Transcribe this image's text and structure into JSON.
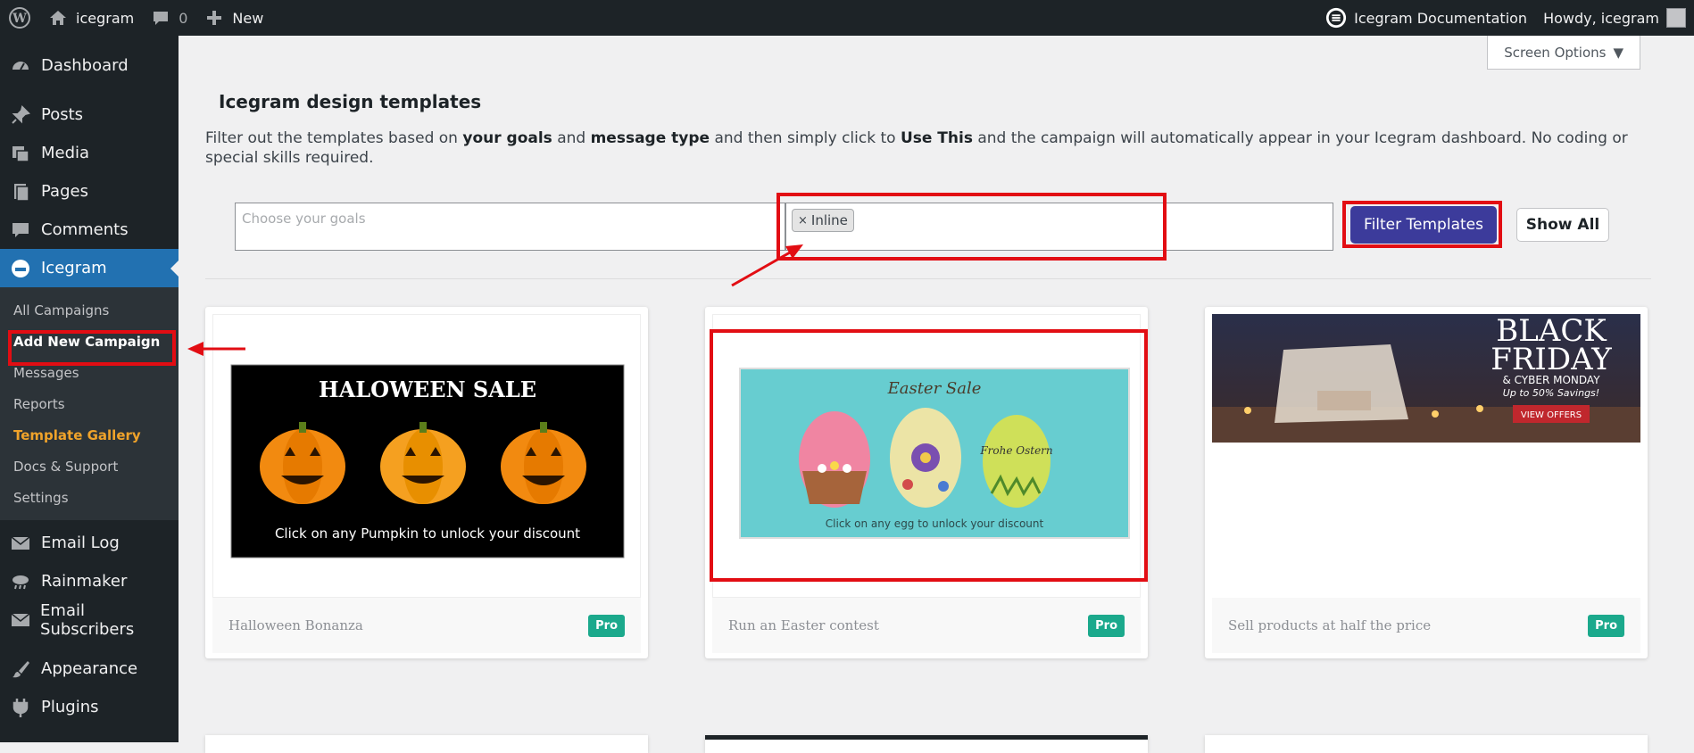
{
  "adminbar": {
    "site_name": "icegram",
    "comments_count": "0",
    "new_label": "New",
    "docs_label": "Icegram Documentation",
    "howdy": "Howdy, icegram"
  },
  "sidebar": {
    "items": [
      {
        "label": "Dashboard",
        "icon": "dashboard-icon"
      },
      {
        "label": "Posts",
        "icon": "pin-icon"
      },
      {
        "label": "Media",
        "icon": "media-icon"
      },
      {
        "label": "Pages",
        "icon": "pages-icon"
      },
      {
        "label": "Comments",
        "icon": "comment-icon"
      },
      {
        "label": "Icegram",
        "icon": "icegram-icon"
      },
      {
        "label": "Email Log",
        "icon": "email-icon"
      },
      {
        "label": "Rainmaker",
        "icon": "cloud-icon"
      },
      {
        "label": "Email Subscribers",
        "icon": "email-icon"
      },
      {
        "label": "Appearance",
        "icon": "brush-icon"
      },
      {
        "label": "Plugins",
        "icon": "plug-icon"
      }
    ],
    "submenu": [
      "All Campaigns",
      "Add New Campaign",
      "Messages",
      "Reports",
      "Template Gallery",
      "Docs & Support",
      "Settings"
    ]
  },
  "main": {
    "screen_options": "Screen Options",
    "title": "Icegram design templates",
    "desc_1": "Filter out the templates based on ",
    "desc_b1": "your goals",
    "desc_2": " and ",
    "desc_b2": "message type",
    "desc_3": " and then simply click to ",
    "desc_b3": "Use This",
    "desc_4": " and the campaign will automatically appear in your Icegram dashboard. No coding or special skills required.",
    "goals_placeholder": "Choose your goals",
    "type_tag": "Inline",
    "filter_button": "Filter Templates",
    "show_all_button": "Show All"
  },
  "cards": [
    {
      "title": "Halloween Bonanza",
      "badge": "Pro",
      "heading": "HALOWEEN SALE",
      "caption": "Click on any Pumpkin to unlock your discount"
    },
    {
      "title": "Run an Easter contest",
      "badge": "Pro",
      "heading": "Easter Sale",
      "egg_text": "Frohe Ostern",
      "caption": "Click on any egg to unlock your discount"
    },
    {
      "title": "Sell products at half the price",
      "badge": "Pro",
      "heading_1": "BLACK",
      "heading_2": "FRIDAY",
      "sub": "& CYBER MONDAY",
      "savings": "Up to 50% Savings!",
      "cta": "VIEW OFFERS"
    }
  ],
  "colors": {
    "admin_bg": "#1d2327",
    "accent": "#2271b1",
    "filter_btn": "#3c3b9b",
    "pro_badge": "#1ba98c",
    "annotation": "#e20d13",
    "active_sub": "#f0a32a"
  }
}
